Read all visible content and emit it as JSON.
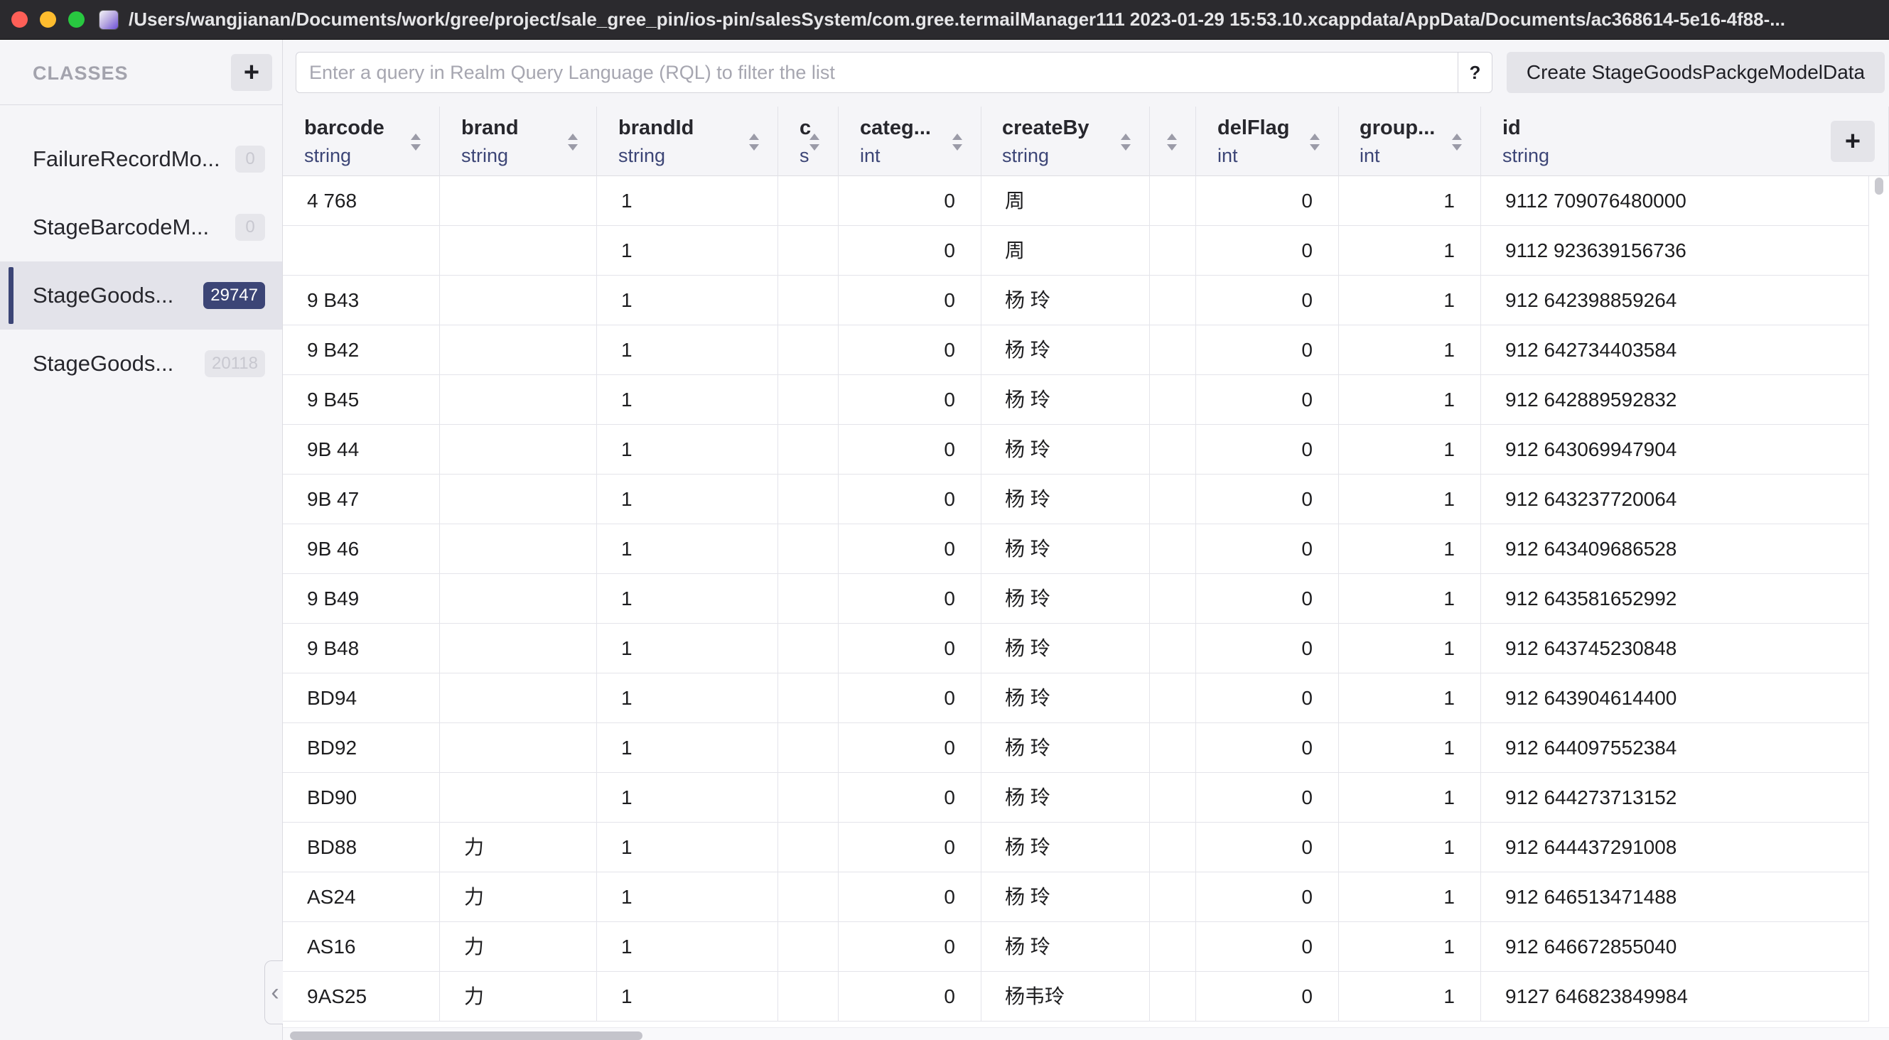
{
  "window": {
    "title": "/Users/wangjianan/Documents/work/gree/project/sale_gree_pin/ios-pin/salesSystem/com.gree.termailManager111 2023-01-29 15:53.10.xcappdata/AppData/Documents/ac368614-5e16-4f88-..."
  },
  "sidebar": {
    "heading": "CLASSES",
    "add_label": "+",
    "collapse_glyph": "‹",
    "items": [
      {
        "name": "FailureRecordMo...",
        "count": "0"
      },
      {
        "name": "StageBarcodeM...",
        "count": "0"
      },
      {
        "name": "StageGoods...",
        "count": "29747"
      },
      {
        "name": "StageGoods...",
        "count": "20118"
      }
    ]
  },
  "query": {
    "placeholder": "Enter a query in Realm Query Language (RQL) to filter the list",
    "help_label": "?",
    "create_label": "Create StageGoodsPackgeModelData"
  },
  "grid": {
    "add_column_label": "+",
    "columns": [
      {
        "name": "barcode",
        "type": "string"
      },
      {
        "name": "brand",
        "type": "string"
      },
      {
        "name": "brandId",
        "type": "string"
      },
      {
        "name": "c",
        "type": "s"
      },
      {
        "name": "categ...",
        "type": "int"
      },
      {
        "name": "createBy",
        "type": "string"
      },
      {
        "name": "",
        "type": ""
      },
      {
        "name": "delFlag",
        "type": "int"
      },
      {
        "name": "group...",
        "type": "int"
      },
      {
        "name": "id",
        "type": "string"
      }
    ],
    "rows": [
      [
        "4 768",
        "",
        "1",
        "",
        "0",
        "周 ",
        "",
        "0",
        "1",
        "9112 709076480000"
      ],
      [
        "",
        "",
        "1",
        "",
        "0",
        "周 ",
        "",
        "0",
        "1",
        "9112 923639156736"
      ],
      [
        "9 B43",
        "",
        "1",
        "",
        "0",
        "杨 玲",
        "",
        "0",
        "1",
        "912 642398859264"
      ],
      [
        "9 B42",
        "",
        "1",
        "",
        "0",
        "杨 玲",
        "",
        "0",
        "1",
        "912 642734403584"
      ],
      [
        "9 B45",
        "",
        "1",
        "",
        "0",
        "杨 玲",
        "",
        "0",
        "1",
        "912 642889592832"
      ],
      [
        "9B 44",
        "",
        "1",
        "",
        "0",
        "杨 玲",
        "",
        "0",
        "1",
        "912 643069947904"
      ],
      [
        "9B 47",
        "",
        "1",
        "",
        "0",
        "杨 玲",
        "",
        "0",
        "1",
        "912 643237720064"
      ],
      [
        "9B 46",
        "",
        "1",
        "",
        "0",
        "杨 玲",
        "",
        "0",
        "1",
        "912 643409686528"
      ],
      [
        "9 B49",
        "",
        "1",
        "",
        "0",
        "杨 玲",
        "",
        "0",
        "1",
        "912 643581652992"
      ],
      [
        "9 B48",
        "",
        "1",
        "",
        "0",
        "杨 玲",
        "",
        "0",
        "1",
        "912 643745230848"
      ],
      [
        "BD94",
        "",
        "1",
        "",
        "0",
        "杨 玲",
        "",
        "0",
        "1",
        "912 643904614400"
      ],
      [
        "BD92",
        "",
        "1",
        "",
        "0",
        "杨 玲",
        "",
        "0",
        "1",
        "912 644097552384"
      ],
      [
        "BD90",
        "",
        "1",
        "",
        "0",
        "杨 玲",
        "",
        "0",
        "1",
        "912 644273713152"
      ],
      [
        "BD88",
        "力",
        "1",
        "",
        "0",
        "杨 玲",
        "",
        "0",
        "1",
        "912 644437291008"
      ],
      [
        "AS24",
        "力",
        "1",
        "",
        "0",
        "杨 玲",
        "",
        "0",
        "1",
        "912 646513471488"
      ],
      [
        "AS16",
        "力",
        "1",
        "",
        "0",
        "杨 玲",
        "",
        "0",
        "1",
        "912 646672855040"
      ],
      [
        "9AS25",
        "力",
        "1",
        "",
        "0",
        "杨韦玲",
        "",
        "0",
        "1",
        "9127 646823849984"
      ]
    ]
  },
  "colors": {
    "accent": "#3c4576",
    "titlebar": "#2b2a2e",
    "sidebar_bg": "#f5f5f8"
  }
}
